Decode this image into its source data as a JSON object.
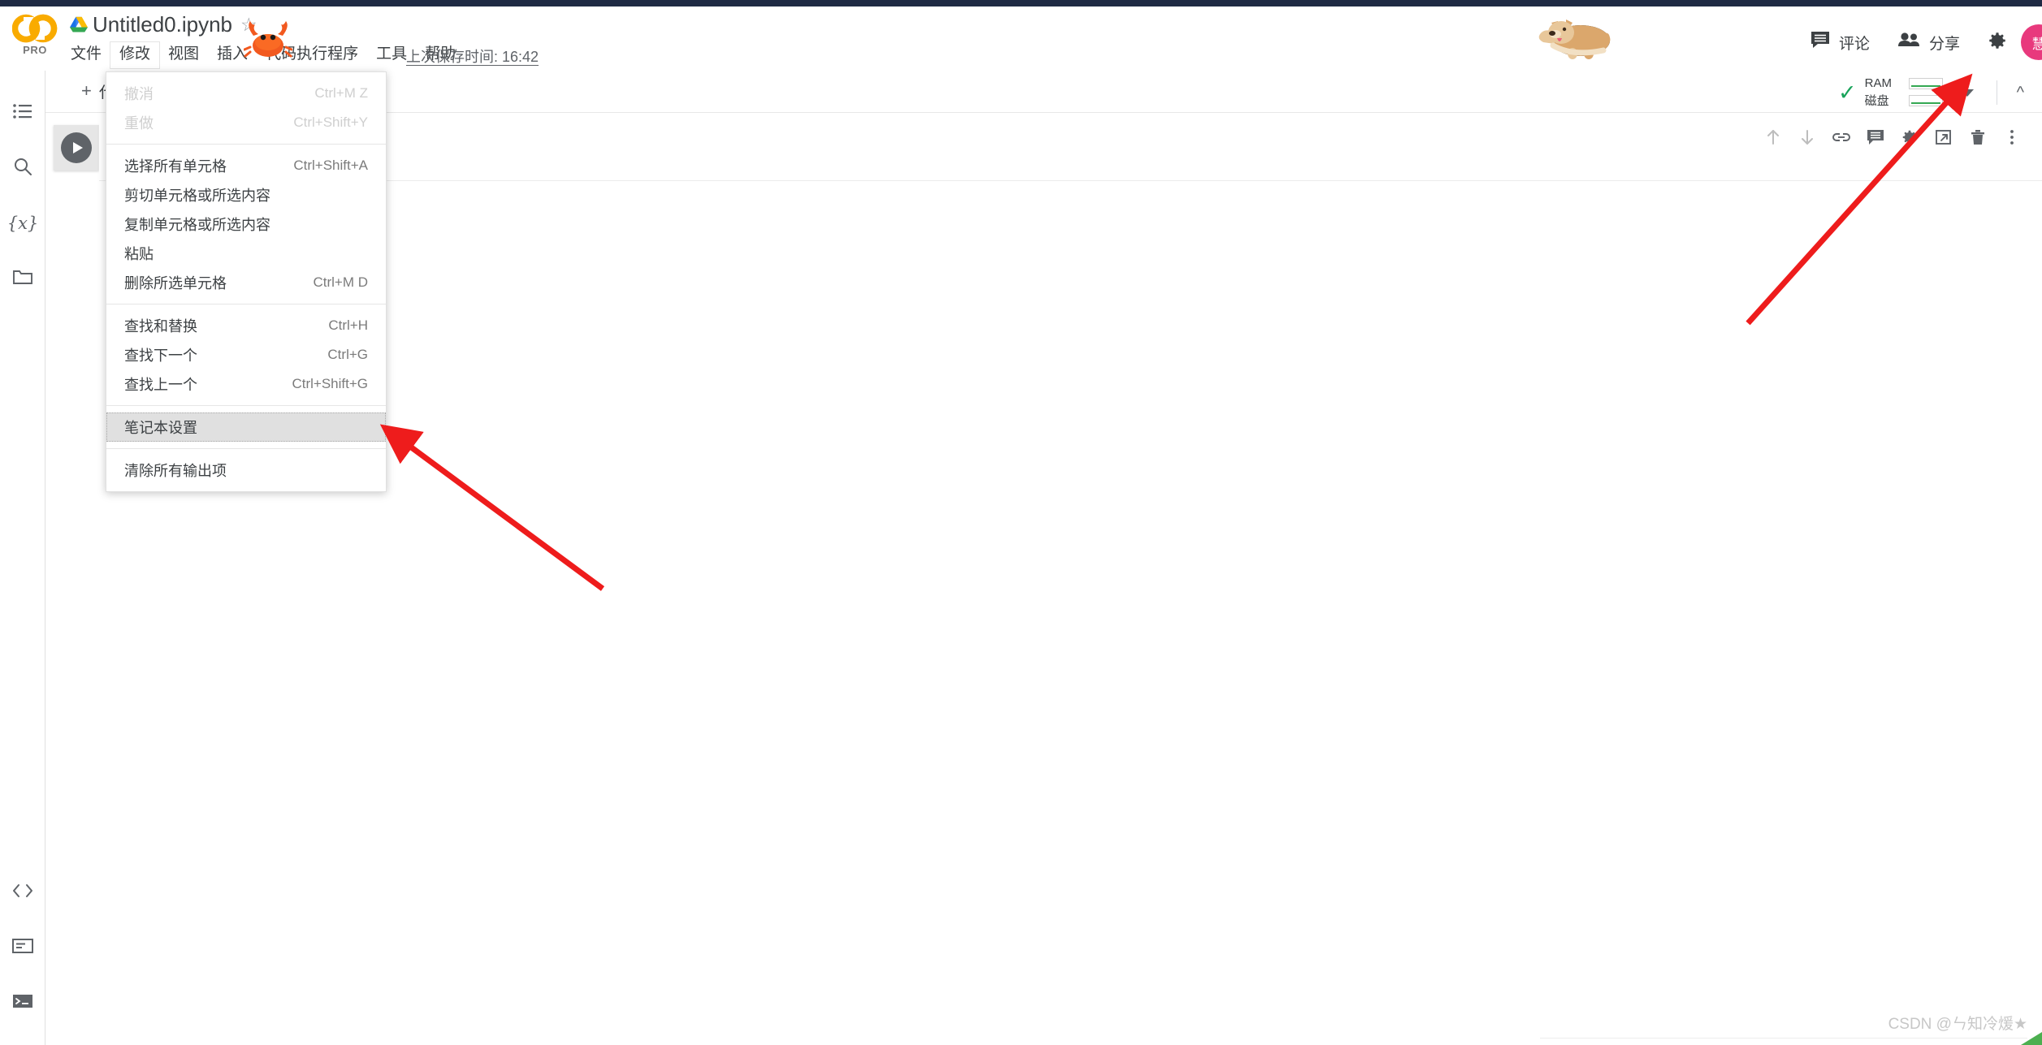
{
  "window": {
    "accent_blue": "#1f2a44",
    "logo_orange": "#f9ab00",
    "avatar_color": "#e8397d"
  },
  "header": {
    "logo_text": "CO",
    "pro_label": "PRO",
    "drive_icon": "drive-icon",
    "file_title": "Untitled0.ipynb",
    "star_icon": "☆",
    "save_time": "上次保存时间: 16:42",
    "corgi_icon": "corgi-dog-icon",
    "crab_icon": "crab-icon",
    "comment_label": "评论",
    "comment_icon": "comment-icon",
    "share_label": "分享",
    "share_icon": "people-icon",
    "settings_icon": "gear-icon",
    "avatar_initials": "慧"
  },
  "menubar": {
    "items": [
      {
        "label": "文件",
        "active": false
      },
      {
        "label": "修改",
        "active": true
      },
      {
        "label": "视图",
        "active": false
      },
      {
        "label": "插入",
        "active": false
      },
      {
        "label": "代码执行程序",
        "active": false
      },
      {
        "label": "工具",
        "active": false
      },
      {
        "label": "帮助",
        "active": false
      }
    ]
  },
  "dropdown": {
    "groups": [
      {
        "items": [
          {
            "label": "撤消",
            "shortcut": "Ctrl+M Z",
            "disabled": true,
            "highlight": false
          },
          {
            "label": "重做",
            "shortcut": "Ctrl+Shift+Y",
            "disabled": true,
            "highlight": false
          }
        ]
      },
      {
        "items": [
          {
            "label": "选择所有单元格",
            "shortcut": "Ctrl+Shift+A",
            "disabled": false,
            "highlight": false
          },
          {
            "label": "剪切单元格或所选内容",
            "shortcut": "",
            "disabled": false,
            "highlight": false
          },
          {
            "label": "复制单元格或所选内容",
            "shortcut": "",
            "disabled": false,
            "highlight": false
          },
          {
            "label": "粘贴",
            "shortcut": "",
            "disabled": false,
            "highlight": false
          },
          {
            "label": "删除所选单元格",
            "shortcut": "Ctrl+M D",
            "disabled": false,
            "highlight": false
          }
        ]
      },
      {
        "items": [
          {
            "label": "查找和替换",
            "shortcut": "Ctrl+H",
            "disabled": false,
            "highlight": false
          },
          {
            "label": "查找下一个",
            "shortcut": "Ctrl+G",
            "disabled": false,
            "highlight": false
          },
          {
            "label": "查找上一个",
            "shortcut": "Ctrl+Shift+G",
            "disabled": false,
            "highlight": false
          }
        ]
      },
      {
        "items": [
          {
            "label": "笔记本设置",
            "shortcut": "",
            "disabled": false,
            "highlight": true
          }
        ]
      },
      {
        "items": [
          {
            "label": "清除所有输出项",
            "shortcut": "",
            "disabled": false,
            "highlight": false
          }
        ]
      }
    ]
  },
  "sidebar": {
    "top_items": [
      {
        "name": "table-of-contents-icon",
        "label": "目录"
      },
      {
        "name": "search-icon",
        "label": "搜索"
      },
      {
        "name": "variables-icon",
        "label": "{x}"
      },
      {
        "name": "files-folder-icon",
        "label": "文件"
      }
    ],
    "bottom_items": [
      {
        "name": "code-snippets-icon",
        "label": "<>"
      },
      {
        "name": "command-palette-icon",
        "label": "命令面板"
      },
      {
        "name": "terminal-icon",
        "label": "终端"
      }
    ]
  },
  "toolbar": {
    "add_code_label": "代码",
    "add_plus": "+",
    "status_check": "✓",
    "ram_label": "RAM",
    "disk_label": "磁盘",
    "gauge_color": "#34a853"
  },
  "cell": {
    "run_button": "run-cell-button",
    "toolbar_icons": [
      {
        "name": "move-cell-up-icon",
        "glyph": "↑",
        "dim": true
      },
      {
        "name": "move-cell-down-icon",
        "glyph": "↓",
        "dim": true
      },
      {
        "name": "link-to-cell-icon",
        "glyph": "link",
        "dim": false
      },
      {
        "name": "add-comment-icon",
        "glyph": "comment",
        "dim": false
      },
      {
        "name": "cell-settings-icon",
        "glyph": "gear",
        "dim": false
      },
      {
        "name": "open-in-new-tab-icon",
        "glyph": "mirror",
        "dim": false
      },
      {
        "name": "delete-cell-icon",
        "glyph": "trash",
        "dim": false
      },
      {
        "name": "more-options-icon",
        "glyph": "⋮",
        "dim": false
      }
    ]
  },
  "annotations": {
    "arrow_color": "#ee1c1c",
    "arrow_to_settings": "arrow pointing to notebook-settings menu item",
    "arrow_to_ram": "arrow pointing to RAM/disk status area"
  },
  "watermark": {
    "text": "CSDN @ㄣ知冷煖★"
  }
}
